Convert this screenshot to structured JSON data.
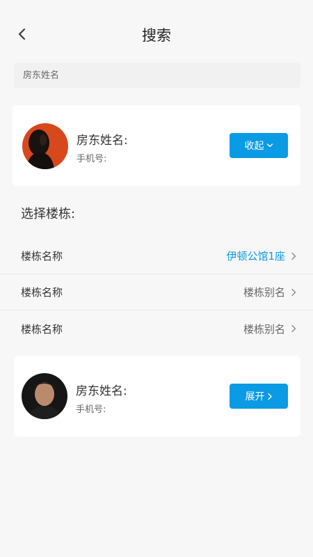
{
  "header": {
    "title": "搜索"
  },
  "search": {
    "placeholder": "房东姓名"
  },
  "landlord_cards": [
    {
      "name_label": "房东姓名:",
      "phone_label": "手机号:",
      "button_label": "收起",
      "button_icon": "chevron-down-icon"
    },
    {
      "name_label": "房东姓名:",
      "phone_label": "手机号:",
      "button_label": "展开",
      "button_icon": "chevron-right-icon"
    }
  ],
  "building_section": {
    "title": "选择楼栋:",
    "rows": [
      {
        "label": "楼栋名称",
        "value": "伊顿公馆1座",
        "selected": true
      },
      {
        "label": "楼栋名称",
        "value": "楼栋别名",
        "selected": false
      },
      {
        "label": "楼栋名称",
        "value": "楼栋别名",
        "selected": false
      }
    ]
  },
  "colors": {
    "accent": "#0b9ae4",
    "background": "#f7f7f7",
    "card": "#ffffff"
  }
}
